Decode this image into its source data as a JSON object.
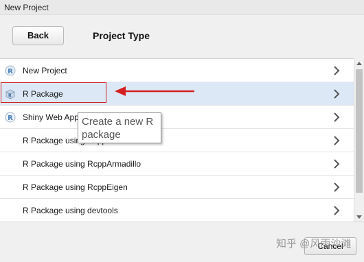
{
  "window": {
    "title": "New Project"
  },
  "header": {
    "back_label": "Back",
    "title": "Project Type"
  },
  "list": {
    "items": [
      {
        "label": "New Project",
        "icon": "r-icon"
      },
      {
        "label": "R Package",
        "icon": "r-package-icon",
        "selected": true
      },
      {
        "label": "Shiny Web App",
        "icon": "shiny-r-icon"
      },
      {
        "label": "R Package using Rcpp",
        "icon": ""
      },
      {
        "label": "R Package using RcppArmadillo",
        "icon": ""
      },
      {
        "label": "R Package using RcppEigen",
        "icon": ""
      },
      {
        "label": "R Package using devtools",
        "icon": ""
      }
    ]
  },
  "tooltip": {
    "text": "Create a new R package"
  },
  "footer": {
    "cancel_label": "Cancel"
  },
  "watermark": {
    "text": "知乎 @风雨沙滩"
  },
  "colors": {
    "annotation": "#d42020",
    "selected_row": "#dce8f6",
    "r_blue": "#5b8fc7"
  }
}
